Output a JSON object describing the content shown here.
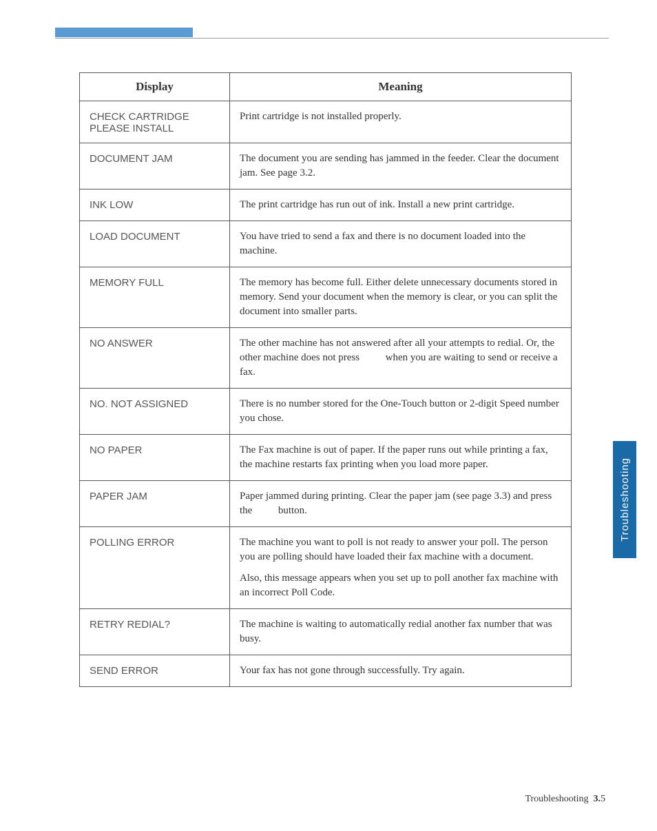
{
  "header": {
    "col1": "Display",
    "col2": "Meaning"
  },
  "rows": [
    {
      "display": "CHECK CARTRIDGE\nPLEASE INSTALL",
      "meaning": [
        "Print cartridge is not installed properly."
      ]
    },
    {
      "display": "DOCUMENT JAM",
      "meaning": [
        "The document you are sending has jammed in the feeder. Clear the document jam. See page 3.2."
      ]
    },
    {
      "display": "INK LOW",
      "meaning": [
        "The print cartridge has run out of ink. Install a new print cartridge."
      ]
    },
    {
      "display": "LOAD DOCUMENT",
      "meaning": [
        "You have tried to send a fax and there is no document loaded into the machine."
      ]
    },
    {
      "display": "MEMORY FULL",
      "meaning": [
        "The memory has become full. Either delete unnecessary documents stored in memory. Send your document when the memory is clear, or you can split the document into smaller parts."
      ]
    },
    {
      "display": "NO ANSWER",
      "meaning_parts": {
        "a": "The other machine has not answered after all your attempts to redial. Or, the other machine does not press ",
        "b": " when you are waiting to send or receive a fax."
      }
    },
    {
      "display": "NO. NOT ASSIGNED",
      "meaning": [
        "There is no number stored for the One-Touch button or 2-digit Speed number you chose."
      ]
    },
    {
      "display": "NO PAPER",
      "meaning": [
        "The Fax machine is out of paper. If the paper runs out while printing a fax, the machine restarts fax printing when you load more paper."
      ]
    },
    {
      "display": "PAPER JAM",
      "meaning_parts": {
        "a": "Paper jammed during printing. Clear the paper jam (see page 3.3) and press the ",
        "b": " button."
      }
    },
    {
      "display": "POLLING ERROR",
      "meaning": [
        "The machine you want to poll is not ready to answer your poll. The person you are polling should have loaded their fax machine with a document.",
        "Also, this message appears when you set up to poll another fax machine with an incorrect Poll Code."
      ]
    },
    {
      "display": "RETRY REDIAL?",
      "meaning": [
        "The machine is waiting to automatically redial another fax number that was busy."
      ]
    },
    {
      "display": "SEND ERROR",
      "meaning": [
        "Your fax has not gone through successfully. Try again."
      ]
    }
  ],
  "side_tab": "Troubleshooting",
  "footer": {
    "label": "Troubleshooting",
    "chapter": "3.",
    "page": "5"
  }
}
